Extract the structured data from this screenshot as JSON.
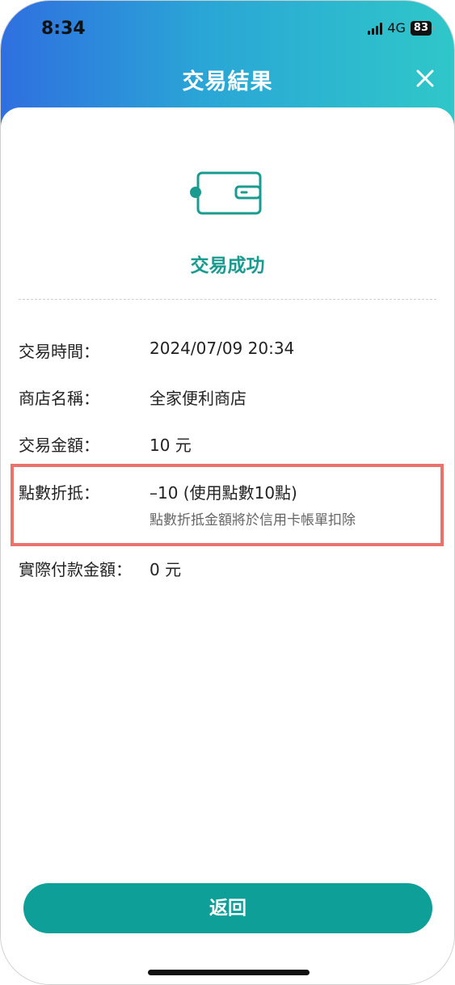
{
  "status_bar": {
    "time": "8:34",
    "network": "4G",
    "battery": "83"
  },
  "header": {
    "title": "交易結果",
    "close_icon": "close-icon"
  },
  "result": {
    "icon": "wallet-icon",
    "status_text": "交易成功"
  },
  "details": [
    {
      "label": "交易時間：",
      "value": "2024/07/09 20:34"
    },
    {
      "label": "商店名稱：",
      "value": "全家便利商店"
    },
    {
      "label": "交易金額：",
      "value": "10 元"
    },
    {
      "label": "點數折抵：",
      "value": "–10 (使用點數10點)",
      "note": "點數折抵金額將於信用卡帳單扣除"
    },
    {
      "label": "實際付款金額：",
      "value": "0 元"
    }
  ],
  "footer": {
    "return_label": "返回"
  },
  "colors": {
    "accent": "#1a9b8f",
    "button": "#0e9f98",
    "highlight": "#e9726c"
  }
}
